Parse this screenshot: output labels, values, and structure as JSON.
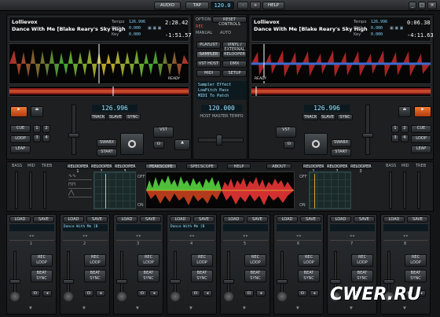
{
  "topbar": {
    "audio": "AUDIO",
    "tap": "TAP",
    "bpm": "120.0",
    "minus": "-",
    "plus": "+",
    "help": "HELP"
  },
  "deck_left": {
    "artist": "Lollievox",
    "track": "Dance With Me [Blake Reary's Sky High",
    "time": "2:28.42",
    "remain": "-1:51.57",
    "tempo_label": "Tempo",
    "tempo": "126.996",
    "pitch_label": "Pitch",
    "pitch": "0.000",
    "key_label": "Key",
    "key": "0.000",
    "bpm": "126.996",
    "track_lbl": "TRACK",
    "slave_lbl": "SLAVE",
    "sync_lbl": "SYNC",
    "cue": "CUE",
    "loop": "LOOP",
    "leap": "LEAP",
    "swab": "SWABX",
    "start": "START",
    "vst": "VST",
    "ready": "READY",
    "pads": [
      "1",
      "2",
      "3",
      "4"
    ]
  },
  "deck_right": {
    "artist": "Lollievox",
    "track": "Dance With Me [Blake Reary's Sky High",
    "time": "0:06.38",
    "remain": "-4:11.63",
    "tempo_label": "Tempo",
    "tempo": "126.996",
    "pitch_label": "Pitch",
    "pitch": "0.000",
    "key_label": "Key",
    "key": "0.000",
    "bpm": "126.996",
    "track_lbl": "TRACK",
    "slave_lbl": "SLAVE",
    "sync_lbl": "SYNC",
    "cue": "CUE",
    "loop": "LOOP",
    "leap": "LEAP",
    "swab": "SWABX",
    "start": "START",
    "vst": "VST",
    "ready": "READY",
    "pads": [
      "1",
      "2",
      "3",
      "4"
    ]
  },
  "center": {
    "option": "OPTION",
    "reset": "RESET CONTROLS",
    "rec": "REC",
    "manual": "MANUAL",
    "auto": "AUTO",
    "menu": [
      [
        "PLAYLIST",
        "VINYL / EXTERNAL"
      ],
      [
        "SAMPLER",
        "RELOOPER"
      ],
      [
        "VST HOST",
        "DMX"
      ],
      [
        "MIDI",
        "SETUP"
      ]
    ],
    "info": [
      "Sampler Effect",
      "LowPitch Pass",
      "MIDI To Patch"
    ],
    "master_bpm": "120.000",
    "master_lbl": "HOST MASTER TEMPO"
  },
  "fx": {
    "left_labels": [
      "BASS",
      "MID",
      "TREB"
    ],
    "left_tabs": [
      "RELOOPER 1",
      "RELOOPER 2",
      "RELOOPER 3"
    ],
    "mid_tabs": [
      "PEAKSCOPE",
      "SPECSCOPE",
      "HELP",
      "ABOUT"
    ],
    "right_tabs": [
      "RELOOPER 1",
      "RELOOPER 2",
      "RELOOPER 3"
    ],
    "right_labels": [
      "BASS",
      "MID",
      "TREB"
    ],
    "off": "OFF",
    "on": "ON"
  },
  "channels": [
    {
      "num": "1",
      "load": "LOAD",
      "save": "SAVE",
      "name": "",
      "rec": "REC",
      "loop": "LOOP",
      "beat": "BEAT",
      "sync": "SYNC"
    },
    {
      "num": "2",
      "load": "LOAD",
      "save": "SAVE",
      "name": "Dance With Me [B",
      "rec": "REC",
      "loop": "LOOP",
      "beat": "BEAT",
      "sync": "SYNC"
    },
    {
      "num": "3",
      "load": "LOAD",
      "save": "SAVE",
      "name": "",
      "rec": "REC",
      "loop": "LOOP",
      "beat": "BEAT",
      "sync": "SYNC"
    },
    {
      "num": "4",
      "load": "LOAD",
      "save": "SAVE",
      "name": "Dance With Me [B",
      "rec": "REC",
      "loop": "LOOP",
      "beat": "BEAT",
      "sync": "SYNC"
    },
    {
      "num": "5",
      "load": "LOAD",
      "save": "SAVE",
      "name": "",
      "rec": "REC",
      "loop": "LOOP",
      "beat": "BEAT",
      "sync": "SYNC"
    },
    {
      "num": "6",
      "load": "LOAD",
      "save": "SAVE",
      "name": "",
      "rec": "REC",
      "loop": "LOOP",
      "beat": "BEAT",
      "sync": "SYNC"
    },
    {
      "num": "7",
      "load": "LOAD",
      "save": "SAVE",
      "name": "",
      "rec": "REC",
      "loop": "LOOP",
      "beat": "BEAT",
      "sync": "SYNC"
    },
    {
      "num": "8",
      "load": "LOAD",
      "save": "SAVE",
      "name": "",
      "rec": "REC",
      "loop": "LOOP",
      "beat": "BEAT",
      "sync": "SYNC"
    }
  ],
  "watermark": "CWER.RU",
  "colors": {
    "accent": "#7fd4ff",
    "wave_red": "#d23030",
    "wave_green": "#4fbf3a",
    "wave_yellow": "#e0c030"
  }
}
